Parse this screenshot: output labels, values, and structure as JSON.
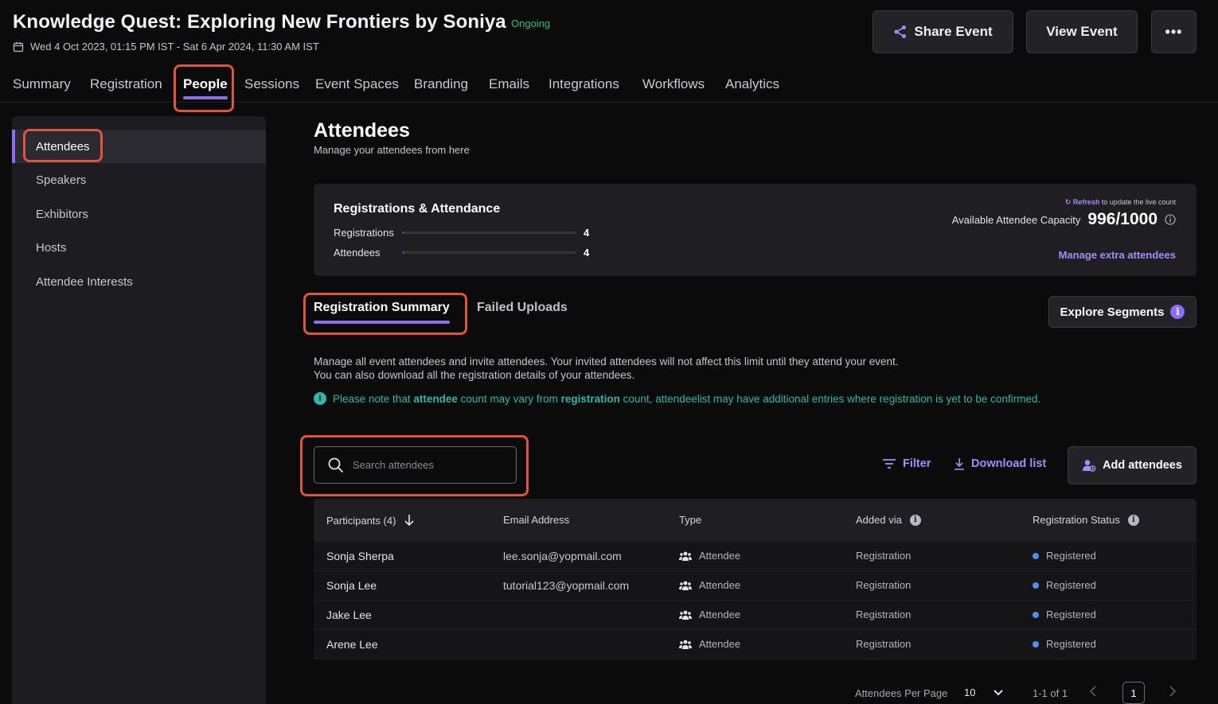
{
  "header": {
    "title": "Knowledge Quest: Exploring New Frontiers by Soniya",
    "status": "Ongoing",
    "dates": "Wed 4 Oct 2023, 01:15 PM IST - Sat 6 Apr 2024, 11:30 AM IST",
    "share_label": "Share Event",
    "view_label": "View Event",
    "more_label": "•••"
  },
  "nav": {
    "tabs": [
      "Summary",
      "Registration",
      "People",
      "Sessions",
      "Event Spaces",
      "Branding",
      "Emails",
      "Integrations",
      "Workflows",
      "Analytics"
    ],
    "active": "People"
  },
  "sidebar": {
    "items": [
      "Attendees",
      "Speakers",
      "Exhibitors",
      "Hosts",
      "Attendee Interests"
    ],
    "active": "Attendees"
  },
  "main": {
    "title": "Attendees",
    "subtitle": "Manage your attendees from here"
  },
  "reg_card": {
    "title": "Registrations & Attendance",
    "rows": [
      {
        "label": "Registrations",
        "value": "4",
        "fill_fraction": 0.004
      },
      {
        "label": "Attendees",
        "value": "4",
        "fill_fraction": 0.004
      }
    ],
    "refresh_link": "Refresh",
    "refresh_text": " to update the live count",
    "capacity_label": "Available Attendee Capacity",
    "capacity_value": "996/1000",
    "manage_link": "Manage extra attendees"
  },
  "subtabs": {
    "registration_summary": "Registration Summary",
    "failed_uploads": "Failed Uploads",
    "explore_segments": "Explore Segments"
  },
  "description": {
    "line1": "Manage all event attendees and invite attendees. Your invited attendees will not affect this limit until they attend your event.",
    "line2": "You can also download all the registration details of your attendees.",
    "note_p1": "Please note that ",
    "note_b1": "attendee",
    "note_p2": " count may vary from ",
    "note_b2": "registration",
    "note_p3": " count, attendeelist may have additional entries where registration is yet to be confirmed."
  },
  "toolbar": {
    "search_placeholder": "Search attendees",
    "filter_label": "Filter",
    "download_label": "Download list",
    "add_label": "Add attendees"
  },
  "table": {
    "headers": [
      "Participants (4)",
      "Email Address",
      "Type",
      "Added via",
      "Registration Status"
    ],
    "rows": [
      {
        "name": "Sonja Sherpa",
        "email": "lee.sonja@yopmail.com",
        "type": "Attendee",
        "added_via": "Registration",
        "status": "Registered"
      },
      {
        "name": "Sonja Lee",
        "email": "tutorial123@yopmail.com",
        "type": "Attendee",
        "added_via": "Registration",
        "status": "Registered"
      },
      {
        "name": "Jake Lee",
        "email": "",
        "type": "Attendee",
        "added_via": "Registration",
        "status": "Registered"
      },
      {
        "name": "Arene Lee",
        "email": "",
        "type": "Attendee",
        "added_via": "Registration",
        "status": "Registered"
      }
    ]
  },
  "pagination": {
    "per_page_label": "Attendees Per Page",
    "per_page_value": "10",
    "range": "1-1 of 1",
    "current_page": "1"
  },
  "colors": {
    "accent": "#8b6cf6",
    "link": "#a58cff",
    "ongoing": "#2fbf7a",
    "note": "#2fb7a8",
    "highlight": "#e0533f",
    "status_dot": "#4f8ef7"
  }
}
